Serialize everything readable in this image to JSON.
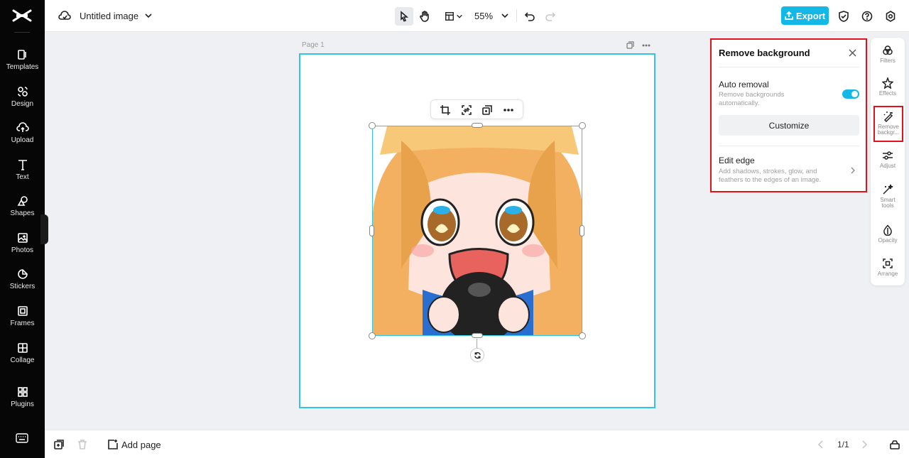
{
  "sidebar": {
    "items": [
      {
        "label": "Templates",
        "icon": "templates-icon"
      },
      {
        "label": "Design",
        "icon": "design-icon"
      },
      {
        "label": "Upload",
        "icon": "upload-icon"
      },
      {
        "label": "Text",
        "icon": "text-icon"
      },
      {
        "label": "Shapes",
        "icon": "shapes-icon"
      },
      {
        "label": "Photos",
        "icon": "photos-icon"
      },
      {
        "label": "Stickers",
        "icon": "stickers-icon"
      },
      {
        "label": "Frames",
        "icon": "frames-icon"
      },
      {
        "label": "Collage",
        "icon": "collage-icon"
      },
      {
        "label": "Plugins",
        "icon": "plugins-icon"
      }
    ]
  },
  "topbar": {
    "title": "Untitled image",
    "zoom": "55%",
    "export_label": "Export",
    "accent_color": "#14b8e6"
  },
  "canvas": {
    "page_label": "Page 1"
  },
  "panel": {
    "title": "Remove background",
    "auto_removal": {
      "title": "Auto removal",
      "description": "Remove backgrounds automatically.",
      "enabled": true
    },
    "customize_label": "Customize",
    "edit_edge": {
      "title": "Edit edge",
      "description": "Add shadows, strokes, glow, and feathers to the edges of an image."
    }
  },
  "right_toolbar": {
    "items": [
      {
        "label": "Filters",
        "icon": "filters-icon"
      },
      {
        "label": "Effects",
        "icon": "effects-icon"
      },
      {
        "label": "Remove backgr...",
        "icon": "remove-background-icon",
        "active": true
      },
      {
        "label": "Adjust",
        "icon": "adjust-icon"
      },
      {
        "label": "Smart tools",
        "icon": "smart-tools-icon"
      },
      {
        "label": "Opacity",
        "icon": "opacity-icon"
      },
      {
        "label": "Arrange",
        "icon": "arrange-icon"
      }
    ]
  },
  "bottombar": {
    "add_page_label": "Add page",
    "pager": "1/1"
  }
}
